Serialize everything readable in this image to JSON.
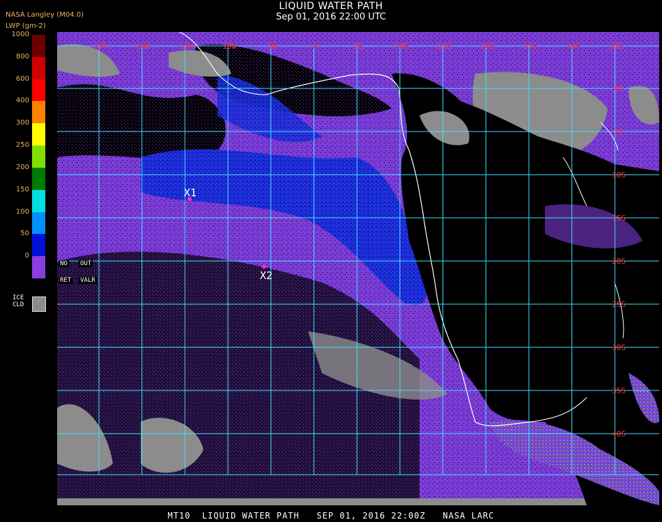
{
  "header": {
    "title": "LIQUID WATER PATH",
    "subtitle": "Sep 01, 2016 22:00 UTC",
    "agency": "NASA Langley (M04.0)",
    "units": "LWP (gm-2)"
  },
  "legend": {
    "ticks": [
      "1000",
      "800",
      "600",
      "400",
      "300",
      "250",
      "200",
      "150",
      "100",
      "50",
      "0"
    ],
    "colors": [
      "#6a0000",
      "#d00000",
      "#ff0000",
      "#ff8000",
      "#ffff00",
      "#80e000",
      "#007a00",
      "#00e0e0",
      "#0090ff",
      "#0010d8",
      "#8a3ee0"
    ],
    "no_retrieval_label": "NO",
    "out_label": "OUT",
    "ret_label": "RET",
    "valr_label": "VALR",
    "ice_label_1": "ICE",
    "ice_label_2": "CLD",
    "ice_color": "#8c8c8c"
  },
  "map": {
    "lon_labels": [
      "25W",
      "20W",
      "15W",
      "10W",
      "5W",
      "0",
      "5E",
      "10E",
      "15E",
      "20E",
      "25E",
      "30E",
      "35E"
    ],
    "lat_labels": [
      "0S",
      "5S",
      "10S",
      "15S",
      "20S",
      "25S",
      "30S",
      "35S",
      "40S"
    ],
    "markers": [
      {
        "label": "X1"
      },
      {
        "label": "X2"
      }
    ],
    "grid_color": "#40e0ff",
    "label_color": "#ff3030",
    "coast_color": "#ffffff"
  },
  "footer": {
    "text": "MT10  LIQUID WATER PATH   SEP 01, 2016 22:00Z   NASA LARC"
  }
}
